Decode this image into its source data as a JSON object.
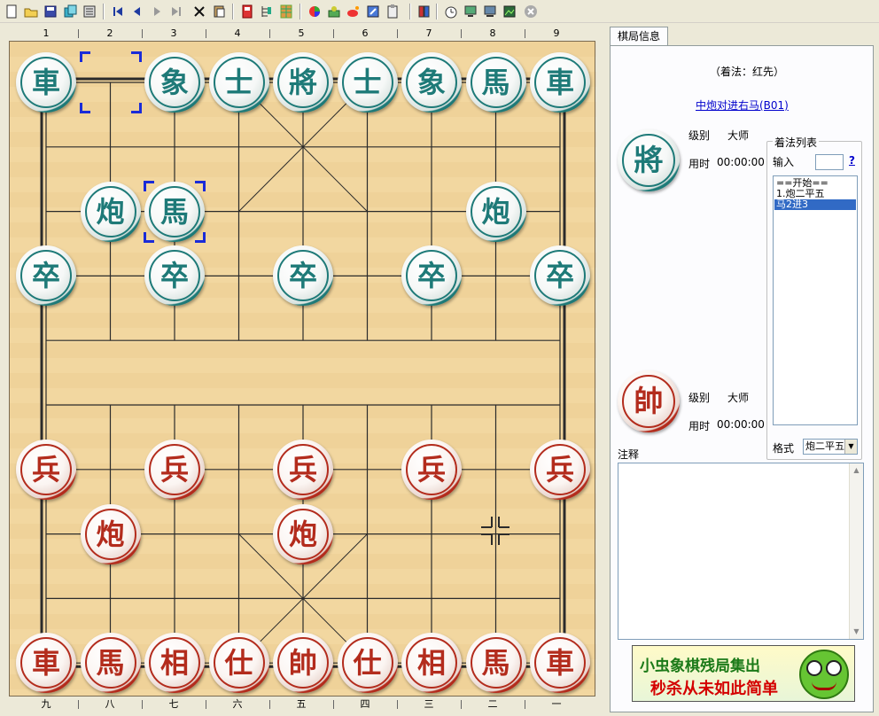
{
  "toolbar": {
    "buttons": [
      "new-file-icon",
      "open-folder-icon",
      "save-icon",
      "copy-icon",
      "settings-icon",
      "first-move-icon",
      "previous-move-icon",
      "next-move-icon",
      "last-move-icon",
      "delete-icon",
      "paste-icon",
      "book-icon",
      "tree-icon",
      "grid-icon",
      "color-wheel-icon",
      "engine-icon",
      "weibo-icon",
      "edit-icon",
      "clipboard-icon",
      "library-icon",
      "timer-icon",
      "computer-icon",
      "network-icon",
      "picture-icon",
      "close-icon"
    ]
  },
  "board": {
    "top_coords": [
      "1",
      "2",
      "3",
      "4",
      "5",
      "6",
      "7",
      "8",
      "9"
    ],
    "bottom_coords": [
      "九",
      "八",
      "七",
      "六",
      "五",
      "四",
      "三",
      "二",
      "一"
    ],
    "pieces": [
      {
        "char": "車",
        "side": "black"
      },
      {
        "char": "象",
        "side": "black"
      },
      {
        "char": "士",
        "side": "black"
      },
      {
        "char": "將",
        "side": "black"
      },
      {
        "char": "士",
        "side": "black"
      },
      {
        "char": "象",
        "side": "black"
      },
      {
        "char": "馬",
        "side": "black"
      },
      {
        "char": "車",
        "side": "black"
      },
      {
        "char": "炮",
        "side": "black"
      },
      {
        "char": "馬",
        "side": "black"
      },
      {
        "char": "炮",
        "side": "black"
      },
      {
        "char": "卒",
        "side": "black"
      },
      {
        "char": "卒",
        "side": "black"
      },
      {
        "char": "卒",
        "side": "black"
      },
      {
        "char": "卒",
        "side": "black"
      },
      {
        "char": "卒",
        "side": "black"
      },
      {
        "char": "兵",
        "side": "red"
      },
      {
        "char": "兵",
        "side": "red"
      },
      {
        "char": "兵",
        "side": "red"
      },
      {
        "char": "兵",
        "side": "red"
      },
      {
        "char": "兵",
        "side": "red"
      },
      {
        "char": "炮",
        "side": "red"
      },
      {
        "char": "炮",
        "side": "red"
      },
      {
        "char": "車",
        "side": "red"
      },
      {
        "char": "馬",
        "side": "red"
      },
      {
        "char": "相",
        "side": "red"
      },
      {
        "char": "仕",
        "side": "red"
      },
      {
        "char": "帥",
        "side": "red"
      },
      {
        "char": "仕",
        "side": "red"
      },
      {
        "char": "相",
        "side": "red"
      },
      {
        "char": "馬",
        "side": "red"
      },
      {
        "char": "車",
        "side": "red"
      }
    ]
  },
  "panel": {
    "tab_label": "棋局信息",
    "move_mode": "（着法：红先）",
    "opening_link": "中炮对进右马(B01)",
    "black_player": {
      "piece": "將",
      "level_label": "级别",
      "level_value": "大师",
      "time_label": "用时",
      "time_value": "00:00:00"
    },
    "red_player": {
      "piece": "帥",
      "level_label": "级别",
      "level_value": "大师",
      "time_label": "用时",
      "time_value": "00:00:00"
    },
    "moves_group_label": "着法列表",
    "input_label": "输入",
    "help_label": "?",
    "moves": [
      "==开始==",
      "1.炮二平五",
      "  马2进3"
    ],
    "format_label": "格式",
    "format_value": "炮二平五",
    "comment_label": "注释",
    "ad_line1": "小虫象棋残局集出",
    "ad_line2": "秒杀从未如此简单"
  },
  "colors": {
    "black_piece": "#1e7a78",
    "red_piece": "#b32c1d",
    "board": "#f2d7a0",
    "selection": "#1a2bd8",
    "list_selection": "#316ac5"
  }
}
